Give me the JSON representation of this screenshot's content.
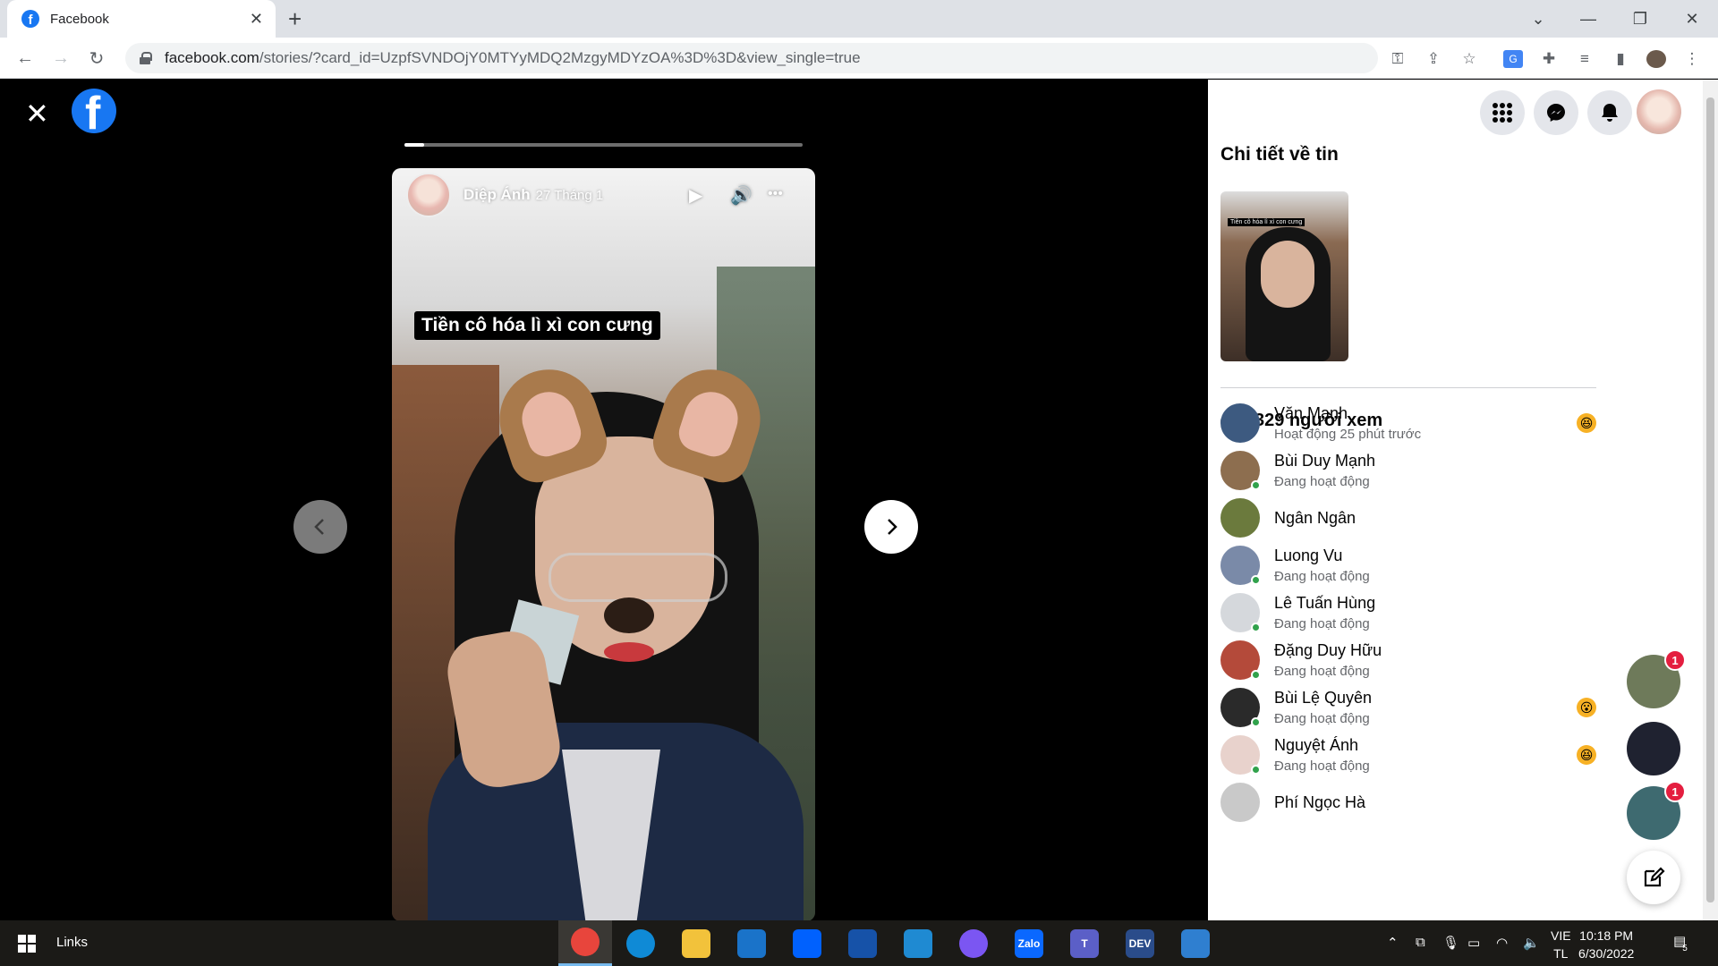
{
  "browser": {
    "tab_title": "Facebook",
    "tab_close": "✕",
    "new_tab": "+",
    "url_host": "facebook.com",
    "url_path": "/stories/?card_id=UzpfSVNDOjY0MTYyMDQ2MzgyMDYzOA%3D%3D&view_single=true"
  },
  "story": {
    "close_label": "✕",
    "logo_letter": "f",
    "progress_fraction": 0.05,
    "author": "Diệp Ánh",
    "date": "27 Tháng 1",
    "caption": "Tiền cô hóa lì xì con cưng",
    "play_icon": "▶",
    "volume_icon": "🔊",
    "more_icon": "•••"
  },
  "panel": {
    "title": "Chi tiết về tin",
    "thumb_caption": "Tiền cô hóa lì xì con cưng",
    "viewer_count": "329 người xem",
    "viewers": [
      {
        "name": "Văn Mạnh",
        "status": "Hoạt động 25 phút trước",
        "online": false,
        "reaction": "😆",
        "avatar_color": "#3d5a80"
      },
      {
        "name": "Bùi Duy Mạnh",
        "status": "Đang hoạt động",
        "online": true,
        "reaction": "",
        "avatar_color": "#8d6e4f"
      },
      {
        "name": "Ngân Ngân",
        "status": "",
        "online": false,
        "reaction": "",
        "avatar_color": "#6b7a3d"
      },
      {
        "name": "Luong Vu",
        "status": "Đang hoạt động",
        "online": true,
        "reaction": "",
        "avatar_color": "#7a8aa8"
      },
      {
        "name": "Lê Tuấn Hùng",
        "status": "Đang hoạt động",
        "online": true,
        "reaction": "",
        "avatar_color": "#d5d8dc"
      },
      {
        "name": "Đặng Duy Hữu",
        "status": "Đang hoạt động",
        "online": true,
        "reaction": "",
        "avatar_color": "#b44a3a"
      },
      {
        "name": "Bùi Lệ Quyên",
        "status": "Đang hoạt động",
        "online": true,
        "reaction": "😮",
        "avatar_color": "#2a2a2a"
      },
      {
        "name": "Nguyệt Ánh",
        "status": "Đang hoạt động",
        "online": true,
        "reaction": "😆",
        "avatar_color": "#e8d2cc"
      },
      {
        "name": "Phí Ngọc Hà",
        "status": "",
        "online": false,
        "reaction": "",
        "avatar_color": "#c9c9c9"
      }
    ],
    "chat_heads": [
      {
        "badge": "1",
        "color": "#6e7a5a"
      },
      {
        "badge": "",
        "color": "#1f2230"
      },
      {
        "badge": "1",
        "color": "#3e6a70"
      }
    ]
  },
  "taskbar": {
    "links_label": "Links",
    "apps": [
      {
        "name": "chrome",
        "label": "",
        "color": "#e8453c"
      },
      {
        "name": "edge",
        "label": "",
        "color": "#0f8ad6"
      },
      {
        "name": "file-explorer",
        "label": "",
        "color": "#f2c23b"
      },
      {
        "name": "mail",
        "label": "",
        "color": "#1a73c9"
      },
      {
        "name": "dropbox",
        "label": "",
        "color": "#0061fe"
      },
      {
        "name": "app-blue",
        "label": "",
        "color": "#1652a8"
      },
      {
        "name": "vscode",
        "label": "",
        "color": "#1f8ad2"
      },
      {
        "name": "messenger",
        "label": "",
        "color": "#7b56f2"
      },
      {
        "name": "zalo",
        "label": "Zalo",
        "color": "#0a68ff"
      },
      {
        "name": "teams",
        "label": "T",
        "color": "#5b5fc7"
      },
      {
        "name": "dev-cpp",
        "label": "DEV",
        "color": "#2a4c8a"
      },
      {
        "name": "photos",
        "label": "",
        "color": "#2f7fd0"
      }
    ],
    "lang_top": "VIE",
    "lang_bottom": "TL",
    "time": "10:18 PM",
    "date": "6/30/2022",
    "notification_count": "5"
  }
}
